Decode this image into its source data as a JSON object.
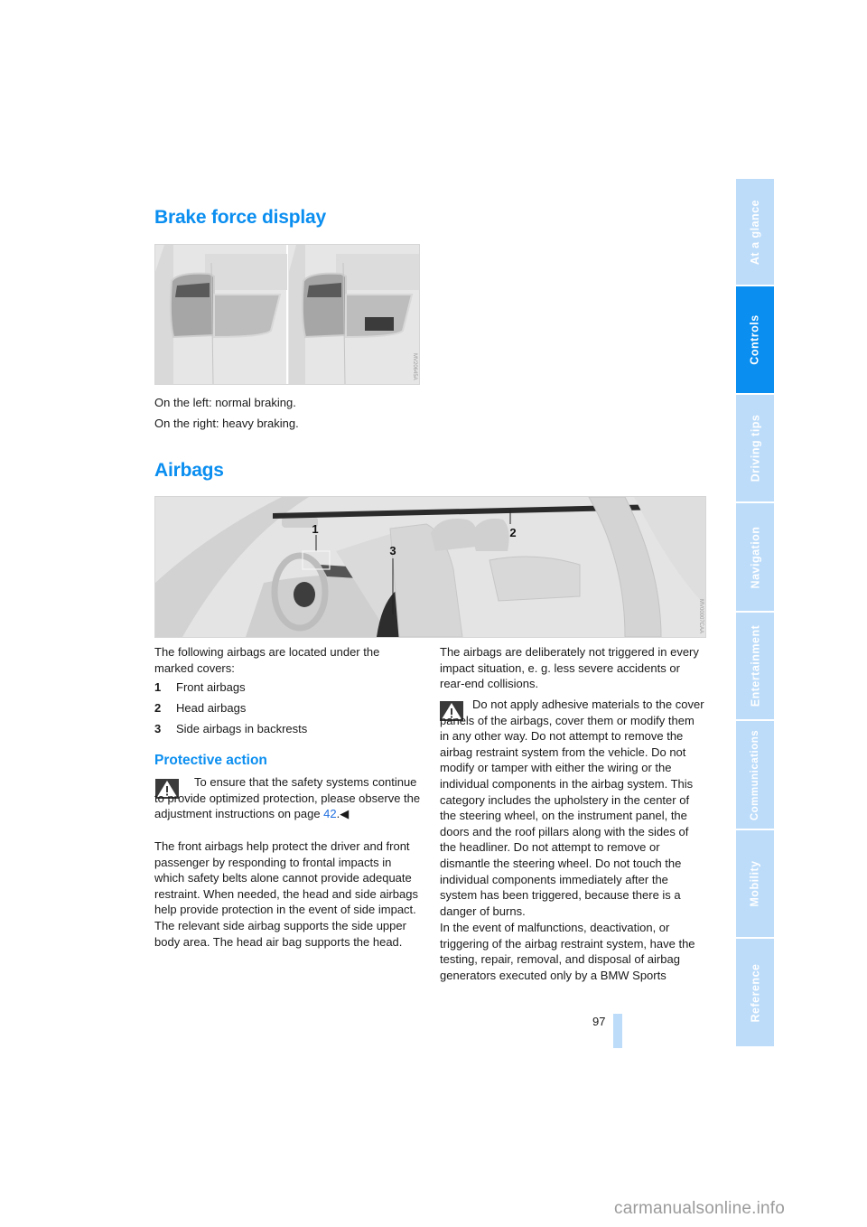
{
  "sections": {
    "brake": {
      "title": "Brake force display",
      "figure_code": "MV20645A",
      "captions": [
        "On the left: normal braking.",
        "On the right: heavy braking."
      ]
    },
    "airbags": {
      "title": "Airbags",
      "figure_code": "MV00007CAA",
      "figure_labels": [
        "1",
        "2",
        "3"
      ],
      "intro": "The following airbags are located under the marked covers:",
      "list": [
        {
          "num": "1",
          "label": "Front airbags"
        },
        {
          "num": "2",
          "label": "Head airbags"
        },
        {
          "num": "3",
          "label": "Side airbags in backrests"
        }
      ]
    },
    "protective": {
      "title": "Protective action",
      "warning1_text": "To ensure that the safety systems continue to provide optimized protection, please observe the adjustment instructions on page ",
      "warning1_link": "42",
      "warning1_end": ".◀",
      "para1": "The front airbags help protect the driver and front passenger by responding to frontal impacts in which safety belts alone cannot provide adequate restraint. When needed, the head and side airbags help provide protection in the event of side impact. The relevant side airbag supports the side upper body area. The head air bag supports the head.",
      "para2": "The airbags are deliberately not triggered in every impact situation, e. g. less severe accidents or rear-end collisions.",
      "warning2_text": "Do not apply adhesive materials to the cover panels of the airbags, cover them or modify them in any other way. Do not attempt to remove the airbag restraint system from the vehicle. Do not modify or tamper with either the wiring or the individual components in the airbag system. This category includes the upholstery in the center of the steering wheel, on the instrument panel, the doors and the roof pillars along with the sides of the headliner. Do not attempt to remove or dismantle the steering wheel. Do not touch the individual components immediately after the system has been triggered, because there is a danger of burns.",
      "para3": "In the event of malfunctions, deactivation, or triggering of the airbag restraint system, have the testing, repair, removal, and disposal of airbag generators executed only by a BMW Sports"
    }
  },
  "sidebar": {
    "tabs": [
      {
        "label": "At a glance",
        "active": false
      },
      {
        "label": "Controls",
        "active": true
      },
      {
        "label": "Driving tips",
        "active": false
      },
      {
        "label": "Navigation",
        "active": false
      },
      {
        "label": "Entertainment",
        "active": false
      },
      {
        "label": "Communications",
        "active": false
      },
      {
        "label": "Mobility",
        "active": false
      },
      {
        "label": "Reference",
        "active": false
      }
    ]
  },
  "page_number": "97",
  "watermark": "carmanualsonline.info",
  "colors": {
    "accent": "#0a8ef0",
    "tab_inactive": "#bcdcfa",
    "link": "#1f6fe0"
  }
}
